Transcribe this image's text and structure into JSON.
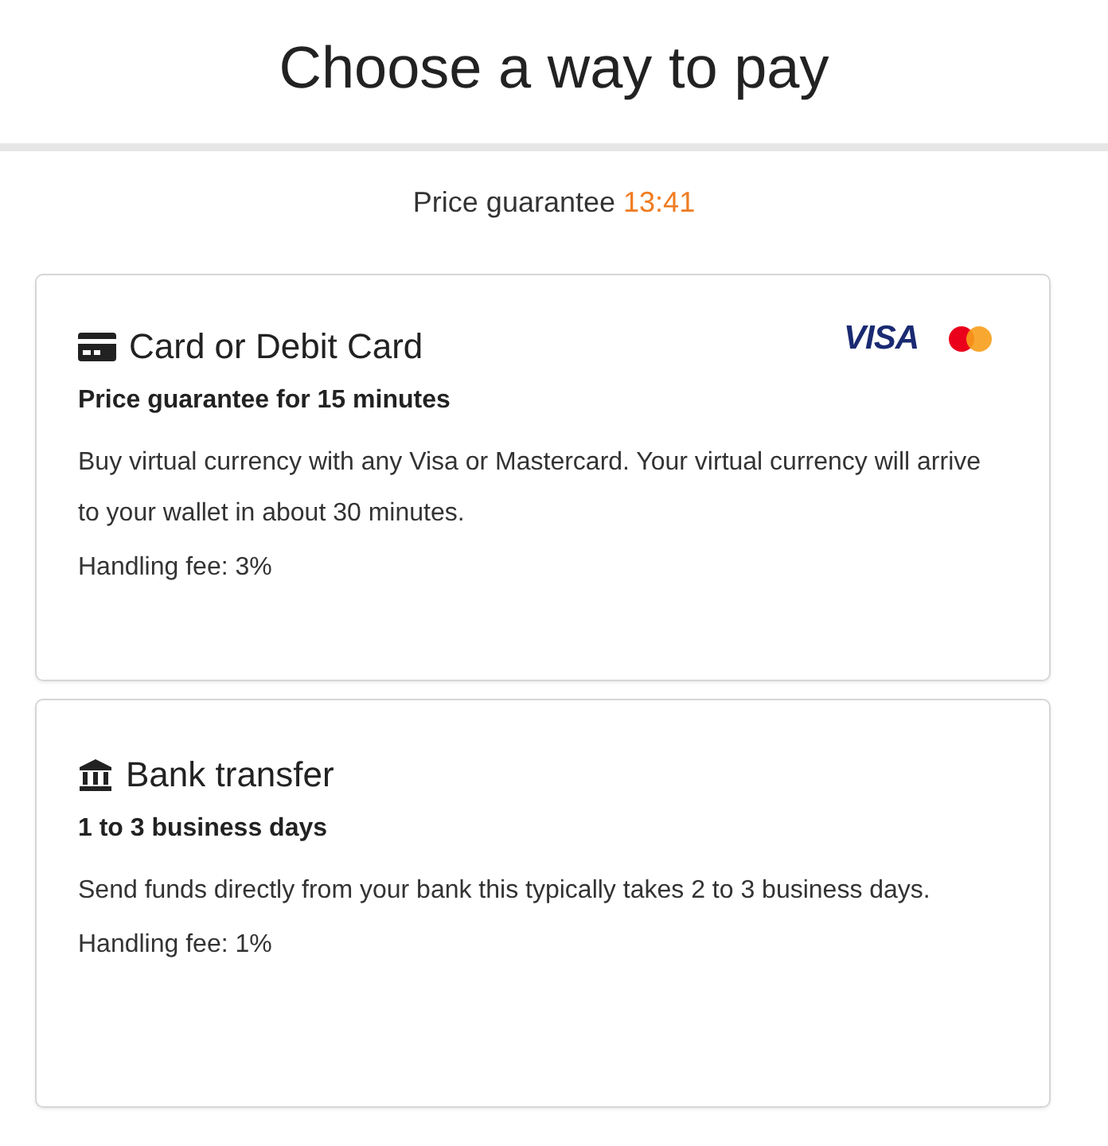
{
  "header": {
    "title": "Choose a way to pay"
  },
  "price_guarantee": {
    "label": "Price guarantee",
    "timer": "13:41"
  },
  "methods": [
    {
      "kind": "card",
      "title": "Card or Debit Card",
      "brands": [
        {
          "kind": "visa",
          "label": "VISA"
        },
        {
          "kind": "mastercard"
        }
      ],
      "subtitle": "Price guarantee for 15 minutes",
      "description": "Buy virtual currency with any Visa or Mastercard. Your virtual currency will arrive to your wallet in about 30 minutes.",
      "fee": "Handling fee: 3%"
    },
    {
      "kind": "bank",
      "title": "Bank transfer",
      "subtitle": "1 to 3 business days",
      "description": "Send funds directly from your bank this typically takes 2 to 3 business days.",
      "fee": "Handling fee: 1%"
    }
  ]
}
